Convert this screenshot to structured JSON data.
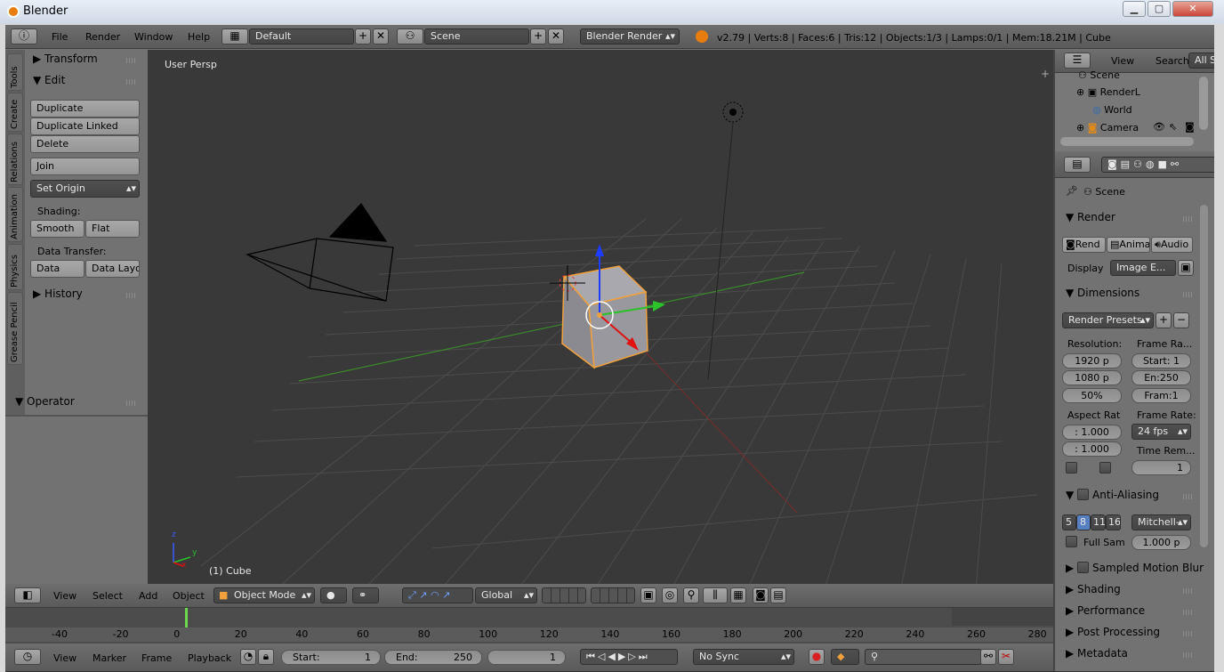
{
  "window": {
    "title": "Blender",
    "minimize": "▁",
    "maximize": "▢",
    "close": "✕"
  },
  "info_header": {
    "menus": [
      "File",
      "Render",
      "Window",
      "Help"
    ],
    "layout": "Default",
    "scene": "Scene",
    "engine": "Blender Render",
    "stats": "v2.79 | Verts:8 | Faces:6 | Tris:12 | Objects:1/3 | Lamps:0/1 | Mem:18.21M | Cube"
  },
  "tool_tabs": [
    "Tools",
    "Create",
    "Relations",
    "Animation",
    "Physics",
    "Grease Pencil"
  ],
  "tool_shelf": {
    "transform": "Transform",
    "edit": "Edit",
    "duplicate": "Duplicate",
    "duplicate_linked": "Duplicate Linked",
    "delete": "Delete",
    "join": "Join",
    "set_origin": "Set Origin",
    "shading_label": "Shading:",
    "smooth": "Smooth",
    "flat": "Flat",
    "data_transfer_label": "Data Transfer:",
    "data": "Data",
    "data_layout": "Data Layo",
    "history": "History",
    "operator": "Operator"
  },
  "viewport": {
    "view_name": "User Persp",
    "object_label": "(1) Cube",
    "axis_x": "x",
    "axis_y": "y",
    "axis_z": "z"
  },
  "view3d_header": {
    "menus": [
      "View",
      "Select",
      "Add",
      "Object"
    ],
    "mode": "Object Mode",
    "orientation": "Global"
  },
  "timeline": {
    "ruler": [
      "-40",
      "-20",
      "0",
      "20",
      "40",
      "60",
      "80",
      "100",
      "120",
      "140",
      "160",
      "180",
      "200",
      "220",
      "240",
      "260",
      "280"
    ],
    "menus": [
      "View",
      "Marker",
      "Frame",
      "Playback"
    ],
    "start_label": "Start:",
    "start": "1",
    "end_label": "End:",
    "end": "250",
    "current": "1",
    "sync": "No Sync"
  },
  "outliner": {
    "view": "View",
    "search": "Search",
    "filter": "All Sc",
    "items": [
      "Scene",
      "RenderL",
      "World",
      "Camera"
    ]
  },
  "properties": {
    "context": "Scene",
    "render_panel": "Render",
    "render_btn": "Rend",
    "anim_btn": "Anima",
    "audio_btn": "Audio",
    "display_label": "Display",
    "display_value": "Image E...",
    "dimensions_panel": "Dimensions",
    "render_presets": "Render Presets",
    "resolution_label": "Resolution:",
    "frame_range_label": "Frame Ra...",
    "res_x": "1920 p",
    "res_y": "1080 p",
    "res_pct": "50%",
    "frame_start": "Start: 1",
    "frame_end": "En:250",
    "frame_step": "Fram:1",
    "aspect_label": "Aspect Rat",
    "framerate_label": "Frame Rate:",
    "aspect_x": ": 1.000",
    "aspect_y": ": 1.000",
    "fps": "24 fps",
    "time_remap_label": "Time Rem...",
    "time_remap_val": "1",
    "aa_panel": "Anti-Aliasing",
    "aa_samples": [
      "5",
      "8",
      "11",
      "16"
    ],
    "aa_filter": "Mitchell-",
    "full_sample": "Full Sam",
    "filter_size": "1.000 p",
    "collapsed_panels": [
      "Sampled Motion Blur",
      "Shading",
      "Performance",
      "Post Processing",
      "Metadata"
    ]
  },
  "colors": {
    "accent": "#5680c2",
    "selection": "#f1a03c"
  }
}
